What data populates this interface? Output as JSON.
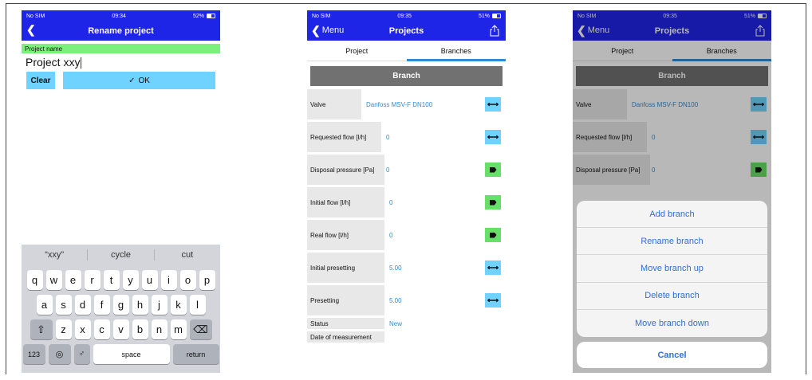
{
  "screen1": {
    "status": {
      "carrier": "No SIM",
      "time": "09:34",
      "battery": "52%"
    },
    "title": "Rename project",
    "field_label": "Project name",
    "field_value": "Project xxy",
    "clear_label": "Clear",
    "ok_label": "OK",
    "suggestions": [
      "“xxy”",
      "cycle",
      "cut"
    ],
    "keys_row1": [
      "q",
      "w",
      "e",
      "r",
      "t",
      "y",
      "u",
      "i",
      "o",
      "p"
    ],
    "keys_row2": [
      "a",
      "s",
      "d",
      "f",
      "g",
      "h",
      "j",
      "k",
      "l"
    ],
    "keys_row3": [
      "z",
      "x",
      "c",
      "v",
      "b",
      "n",
      "m"
    ],
    "key_123": "123",
    "key_space": "space",
    "key_return": "return"
  },
  "screen2": {
    "status": {
      "carrier": "No SIM",
      "time": "09:35",
      "battery": "51%"
    },
    "back_label": "Menu",
    "title": "Projects",
    "tabs": [
      "Project",
      "Branches"
    ],
    "branch_header": "Branch",
    "rows": [
      {
        "label": "Valve",
        "value": "Danfoss MSV-F  DN100",
        "icon": "swap-icon"
      },
      {
        "label": "Requested flow [l/h]",
        "value": "0",
        "icon": "swap-icon"
      },
      {
        "label": "Disposal pressure [Pa]",
        "value": "0",
        "icon": "tag-icon"
      },
      {
        "label": "Initial flow [l/h]",
        "value": "0",
        "icon": "tag-icon"
      },
      {
        "label": "Real flow [l/h]",
        "value": "0",
        "icon": "tag-icon"
      },
      {
        "label": "Initial presetting",
        "value": "5.00",
        "icon": "swap-icon"
      },
      {
        "label": "Presetting",
        "value": "5.00",
        "icon": "swap-icon"
      },
      {
        "label": "Status",
        "value": "New"
      },
      {
        "label": "Date of measurement",
        "value": ""
      }
    ]
  },
  "screen3": {
    "status": {
      "carrier": "No SIM",
      "time": "09:35",
      "battery": "51%"
    },
    "back_label": "Menu",
    "title": "Projects",
    "tabs": [
      "Project",
      "Branches"
    ],
    "branch_header": "Branch",
    "rows": [
      {
        "label": "Valve",
        "value": "Danfoss MSV-F  DN100"
      },
      {
        "label": "Requested flow [l/h]",
        "value": "0"
      },
      {
        "label": "Disposal pressure [Pa]",
        "value": "0"
      }
    ],
    "actions": [
      "Add branch",
      "Rename branch",
      "Move branch up",
      "Delete branch",
      "Move branch down"
    ],
    "cancel_label": "Cancel"
  },
  "colors": {
    "nav_blue": "#1f25e6",
    "button_cyan": "#6fd2ff",
    "label_green": "#7cf07c",
    "link_blue": "#2f8cd8"
  }
}
